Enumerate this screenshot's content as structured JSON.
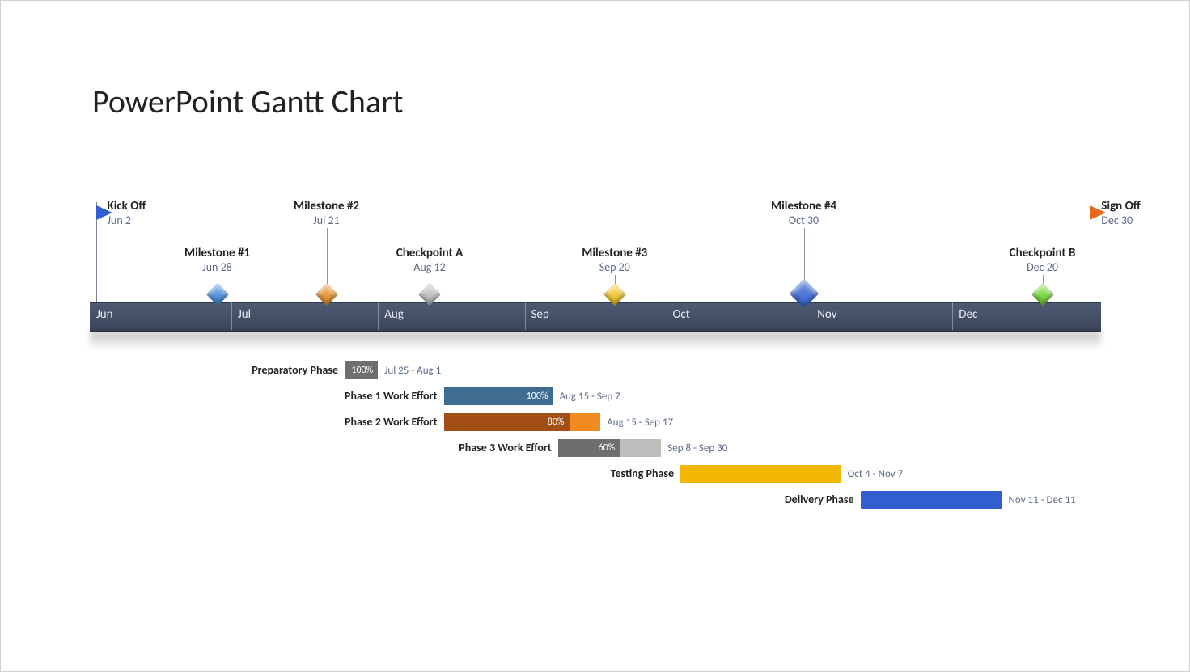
{
  "title": "PowerPoint Gantt Chart",
  "chart_data": {
    "type": "gantt",
    "timeline": {
      "start": "Jun 1",
      "end": "Dec 31",
      "tick_labels": [
        "Jun",
        "Jul",
        "Aug",
        "Sep",
        "Oct",
        "Nov",
        "Dec"
      ],
      "tick_positions_pct": [
        0,
        14.0,
        28.5,
        43.0,
        57.0,
        71.3,
        85.3
      ]
    },
    "milestones": [
      {
        "label": "Kick Off",
        "date": "Jun 2",
        "x_pct": 0.6,
        "shape": "flag",
        "color": "#2f5fd0",
        "row": "top"
      },
      {
        "label": "Milestone #1",
        "date": "Jun 28",
        "x_pct": 12.6,
        "shape": "diamond",
        "color": "#3a86d6",
        "row": "bottom"
      },
      {
        "label": "Milestone #2",
        "date": "Jul 21",
        "x_pct": 23.4,
        "shape": "diamond",
        "color": "#e58a1f",
        "row": "top"
      },
      {
        "label": "Checkpoint A",
        "date": "Aug 12",
        "x_pct": 33.6,
        "shape": "diamond",
        "color": "#b9b9b9",
        "row": "bottom"
      },
      {
        "label": "Milestone #3",
        "date": "Sep 20",
        "x_pct": 51.9,
        "shape": "diamond",
        "color": "#f2c218",
        "row": "bottom"
      },
      {
        "label": "Milestone #4",
        "date": "Oct 30",
        "x_pct": 70.6,
        "shape": "diamond-big",
        "color": "#2f5fd0",
        "row": "top"
      },
      {
        "label": "Checkpoint B",
        "date": "Dec 20",
        "x_pct": 94.2,
        "shape": "diamond",
        "color": "#6fd42a",
        "row": "bottom"
      },
      {
        "label": "Sign Off",
        "date": "Dec 30",
        "x_pct": 98.9,
        "shape": "flag",
        "color": "#e8671a",
        "row": "top"
      }
    ],
    "tasks": [
      {
        "label": "Preparatory Phase",
        "range": "Jul 25 - Aug 1",
        "start_pct": 25.2,
        "end_pct": 28.5,
        "pct": 100,
        "bar_color": "#6e6e6e",
        "fill_color": "#6e6e6e"
      },
      {
        "label": "Phase 1 Work Effort",
        "range": "Aug 15 - Sep 7",
        "start_pct": 35.0,
        "end_pct": 45.8,
        "pct": 100,
        "bar_color": "#3f6d92",
        "fill_color": "#3f6d92"
      },
      {
        "label": "Phase 2 Work Effort",
        "range": "Aug 15 - Sep 17",
        "start_pct": 35.0,
        "end_pct": 50.5,
        "pct": 80,
        "bar_color": "#ef8b1f",
        "fill_color": "#a24e16"
      },
      {
        "label": "Phase 3 Work Effort",
        "range": "Sep 8 - Sep 30",
        "start_pct": 46.3,
        "end_pct": 56.5,
        "pct": 60,
        "bar_color": "#bdbdbd",
        "fill_color": "#6e6e6e"
      },
      {
        "label": "Testing Phase",
        "range": "Oct 4 - Nov 7",
        "start_pct": 58.4,
        "end_pct": 74.3,
        "pct": null,
        "bar_color": "#f2b705",
        "fill_color": "#f2b705"
      },
      {
        "label": "Delivery Phase",
        "range": "Nov 11 - Dec 11",
        "start_pct": 76.2,
        "end_pct": 90.2,
        "pct": null,
        "bar_color": "#2f5fd0",
        "fill_color": "#2f5fd0"
      }
    ]
  }
}
